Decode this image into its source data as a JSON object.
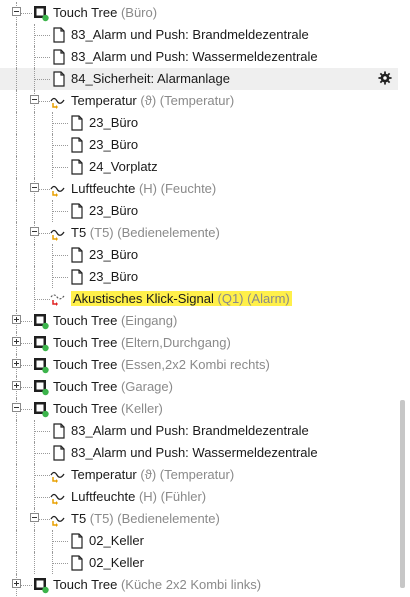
{
  "tree": {
    "rows": [
      {
        "depth": 0,
        "toggle": "minus",
        "icon": "device",
        "label": "Touch Tree",
        "suffix": "(Büro)"
      },
      {
        "depth": 1,
        "icon": "page",
        "label": "83_Alarm und Push: Brandmeldezentrale"
      },
      {
        "depth": 1,
        "icon": "page",
        "label": "83_Alarm und Push: Wassermeldezentrale"
      },
      {
        "depth": 1,
        "icon": "page",
        "label": "84_Sicherheit: Alarmanlage",
        "selected": true,
        "gear": true
      },
      {
        "depth": 1,
        "toggle": "minus",
        "icon": "func",
        "label": "Temperatur",
        "suffix": "(ϑ) (Temperatur)"
      },
      {
        "depth": 2,
        "icon": "page",
        "label": "23_Büro"
      },
      {
        "depth": 2,
        "icon": "page",
        "label": "23_Büro"
      },
      {
        "depth": 2,
        "icon": "page",
        "label": "24_Vorplatz"
      },
      {
        "depth": 1,
        "toggle": "minus",
        "icon": "func",
        "label": "Luftfeuchte",
        "suffix": "(H) (Feuchte)"
      },
      {
        "depth": 2,
        "icon": "page",
        "label": "23_Büro"
      },
      {
        "depth": 1,
        "toggle": "minus",
        "icon": "func",
        "label": "T5",
        "suffix": "(T5) (Bedienelemente)"
      },
      {
        "depth": 2,
        "icon": "page",
        "label": "23_Büro"
      },
      {
        "depth": 2,
        "icon": "page",
        "label": "23_Büro"
      },
      {
        "depth": 1,
        "icon": "alarm",
        "label": "Akustisches Klick-Signal",
        "suffix": "(Q1) (Alarm)",
        "highlight": true
      },
      {
        "depth": 0,
        "toggle": "plus",
        "icon": "device",
        "label": "Touch Tree",
        "suffix": "(Eingang)"
      },
      {
        "depth": 0,
        "toggle": "plus",
        "icon": "device",
        "label": "Touch Tree",
        "suffix": "(Eltern,Durchgang)"
      },
      {
        "depth": 0,
        "toggle": "plus",
        "icon": "device",
        "label": "Touch Tree",
        "suffix": "(Essen,2x2 Kombi rechts)"
      },
      {
        "depth": 0,
        "toggle": "plus",
        "icon": "device",
        "label": "Touch Tree",
        "suffix": "(Garage)"
      },
      {
        "depth": 0,
        "toggle": "minus",
        "icon": "device",
        "label": "Touch Tree",
        "suffix": "(Keller)"
      },
      {
        "depth": 1,
        "icon": "page",
        "label": "83_Alarm und Push: Brandmeldezentrale"
      },
      {
        "depth": 1,
        "icon": "page",
        "label": "83_Alarm und Push: Wassermeldezentrale"
      },
      {
        "depth": 1,
        "icon": "func",
        "label": "Temperatur",
        "suffix": "(ϑ) (Temperatur)"
      },
      {
        "depth": 1,
        "icon": "func",
        "label": "Luftfeuchte",
        "suffix": "(H) (Fühler)"
      },
      {
        "depth": 1,
        "toggle": "minus",
        "icon": "func",
        "label": "T5",
        "suffix": "(T5) (Bedienelemente)"
      },
      {
        "depth": 2,
        "icon": "page",
        "label": "02_Keller"
      },
      {
        "depth": 2,
        "icon": "page",
        "label": "02_Keller"
      },
      {
        "depth": 0,
        "toggle": "plus",
        "icon": "device",
        "label": "Touch Tree",
        "suffix": "(Küche 2x2 Kombi links)"
      }
    ]
  },
  "colors": {
    "selected_row": "#efefef",
    "highlight": "#fff04a",
    "online_dot": "#3cb44b",
    "function_arrow": "#e8a000",
    "alarm_arrow": "#e02020",
    "muted_text": "#8a8a8a"
  },
  "icons": {
    "device": "device-online-icon",
    "page": "page-icon",
    "func": "function-icon",
    "alarm": "alarm-function-icon",
    "gear": "gear-icon",
    "toggle_minus": "collapse-icon",
    "toggle_plus": "expand-icon"
  }
}
